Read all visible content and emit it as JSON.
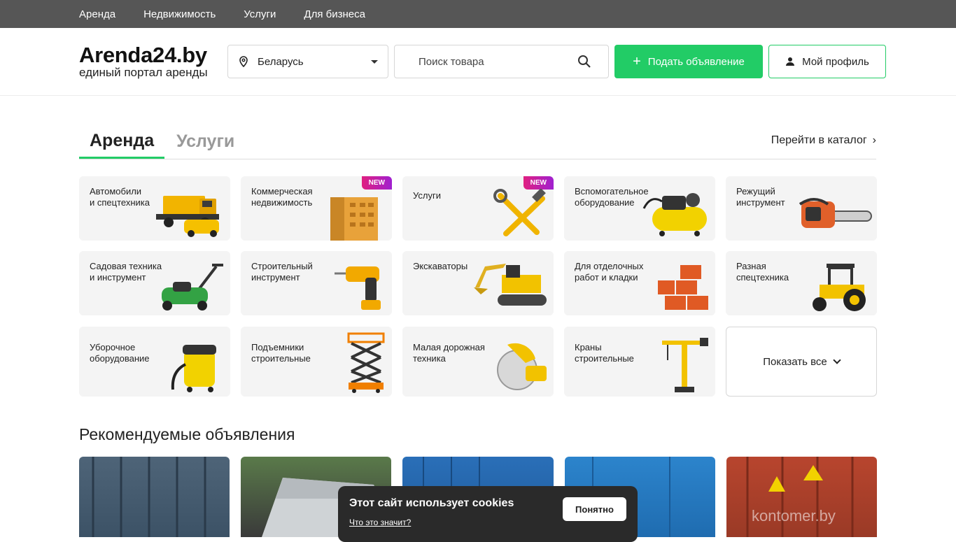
{
  "topnav": [
    "Аренда",
    "Недвижимость",
    "Услуги",
    "Для бизнеса"
  ],
  "header": {
    "logo_title": "Arenda24.by",
    "logo_subtitle": "единый портал аренды",
    "region_value": "Беларусь",
    "search_placeholder": "Поиск товара",
    "post_label": "Подать объявление",
    "profile_label": "Мой профиль"
  },
  "tabs": {
    "rent": "Аренда",
    "services": "Услуги",
    "catalog": "Перейти в каталог"
  },
  "categories": [
    {
      "label": "Автомобили\nи спецтехника",
      "icon": "truck-icon",
      "badge": ""
    },
    {
      "label": "Коммерческая\nнедвижимость",
      "icon": "building-icon",
      "badge": "NEW"
    },
    {
      "label": "Услуги",
      "icon": "tools-icon",
      "badge": "NEW"
    },
    {
      "label": "Вспомогательное\nоборудование",
      "icon": "compressor-icon",
      "badge": ""
    },
    {
      "label": "Режущий\nинструмент",
      "icon": "chainsaw-icon",
      "badge": ""
    },
    {
      "label": "Садовая техника\nи инструмент",
      "icon": "lawnmower-icon",
      "badge": ""
    },
    {
      "label": "Строительный\nинструмент",
      "icon": "drill-icon",
      "badge": ""
    },
    {
      "label": "Экскаваторы",
      "icon": "excavator-icon",
      "badge": ""
    },
    {
      "label": "Для отделочных\nработ и кладки",
      "icon": "bricks-icon",
      "badge": ""
    },
    {
      "label": "Разная\nспецтехника",
      "icon": "tractor-icon",
      "badge": ""
    },
    {
      "label": "Уборочное\nоборудование",
      "icon": "vacuum-icon",
      "badge": ""
    },
    {
      "label": "Подъемники\nстроительные",
      "icon": "scissor-lift-icon",
      "badge": ""
    },
    {
      "label": "Малая дорожная\nтехника",
      "icon": "road-saw-icon",
      "badge": ""
    },
    {
      "label": "Краны\nстроительные",
      "icon": "crane-icon",
      "badge": ""
    }
  ],
  "show_all": "Показать все",
  "recommended_title": "Рекомендуемые объявления",
  "recommended_watermark": "kontomer.by",
  "cookie": {
    "title": "Этот сайт использует cookies",
    "link": "Что это значит?",
    "button": "Понятно"
  },
  "colors": {
    "accent": "#22cc66",
    "topbar": "#565656",
    "card": "#f4f4f4"
  }
}
